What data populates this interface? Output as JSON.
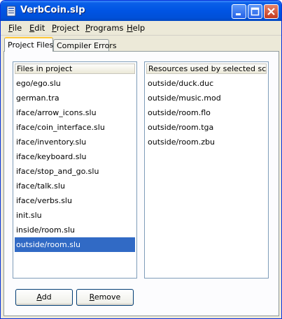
{
  "window": {
    "title": "VerbCoin.slp"
  },
  "menu": [
    {
      "label_first": "F",
      "label_rest": "ile"
    },
    {
      "label_first": "E",
      "label_rest": "dit"
    },
    {
      "label_first": "P",
      "label_rest": "roject"
    },
    {
      "label_first": "P",
      "label_rest": "rograms"
    },
    {
      "label_first": "H",
      "label_rest": "elp"
    }
  ],
  "tabs": {
    "active": "Project Files",
    "inactive": "Compiler Errors"
  },
  "files": {
    "header": "Files in project",
    "items": [
      "ego/ego.slu",
      "german.tra",
      "iface/arrow_icons.slu",
      "iface/coin_interface.slu",
      "iface/inventory.slu",
      "iface/keyboard.slu",
      "iface/stop_and_go.slu",
      "iface/talk.slu",
      "iface/verbs.slu",
      "init.slu",
      "inside/room.slu",
      "outside/room.slu"
    ],
    "selected": "outside/room.slu"
  },
  "resources": {
    "header": "Resources used by selected scripts",
    "items": [
      "outside/duck.duc",
      "outside/music.mod",
      "outside/room.flo",
      "outside/room.tga",
      "outside/room.zbu"
    ]
  },
  "buttons": {
    "add_first": "A",
    "add_rest": "dd",
    "remove_first": "R",
    "remove_rest": "emove"
  }
}
